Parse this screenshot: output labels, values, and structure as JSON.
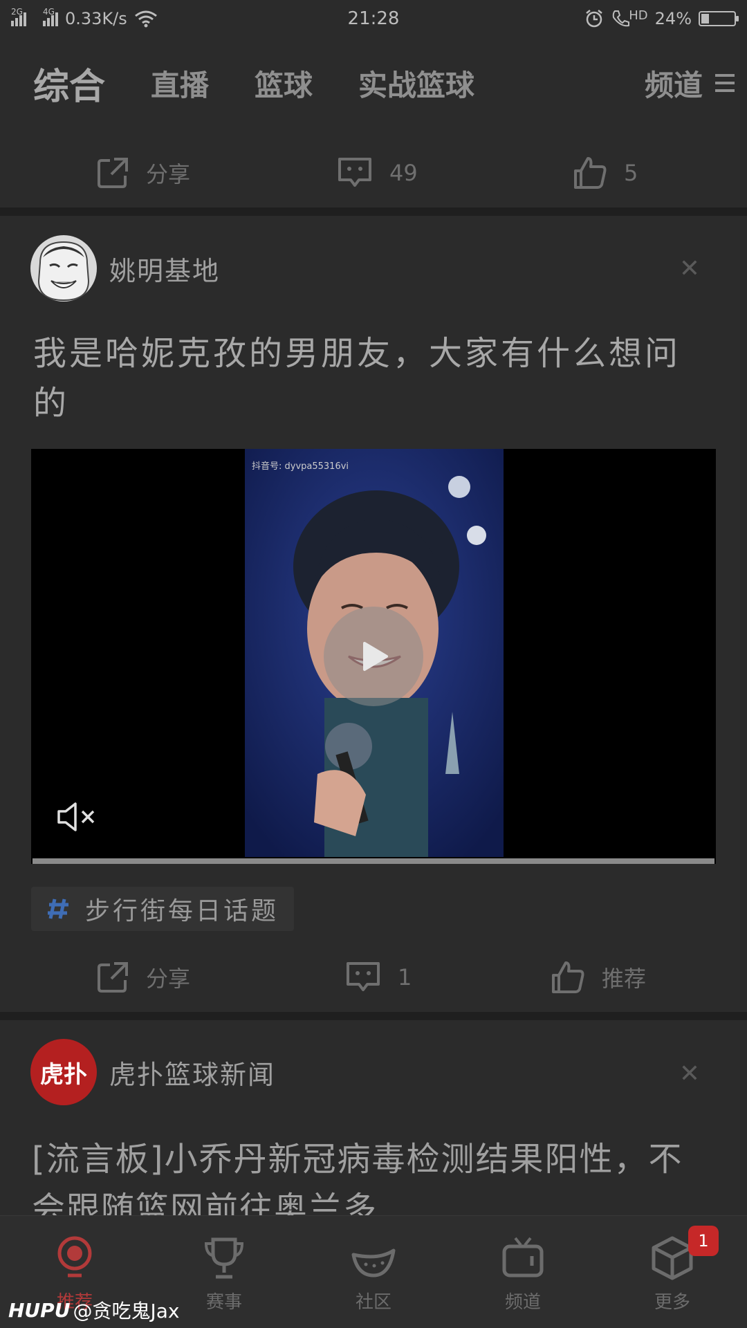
{
  "status_bar": {
    "net1": "2G",
    "net2": "4G",
    "speed": "0.33K/s",
    "time": "21:28",
    "hd": "HD",
    "battery": "24%",
    "battery_level": 0.24
  },
  "top_nav": {
    "tabs": [
      "综合",
      "直播",
      "篮球",
      "实战篮球"
    ],
    "channel": "频道"
  },
  "prev_post": {
    "share": "分享",
    "comments": "49",
    "likes": "5"
  },
  "post1": {
    "author": "姚明基地",
    "title": "我是哈妮克孜的男朋友，大家有什么想问的",
    "video_watermark": "抖音号: dyvpa55316vi",
    "topic": "步行街每日话题",
    "share": "分享",
    "comments": "1",
    "recommend": "推荐"
  },
  "post2": {
    "author": "虎扑篮球新闻",
    "avatar_text": "虎扑",
    "title": "[流言板]小乔丹新冠病毒检测结果阳性，不会跟随篮网前往奥兰多"
  },
  "bottom_nav": {
    "items": [
      "推荐",
      "赛事",
      "社区",
      "频道",
      "更多"
    ],
    "badge": "1"
  },
  "signature": {
    "brand": "HUPU",
    "user": "@贪吃鬼Jax"
  },
  "colors": {
    "accent": "#c62828",
    "background": "#2b2b2b"
  }
}
